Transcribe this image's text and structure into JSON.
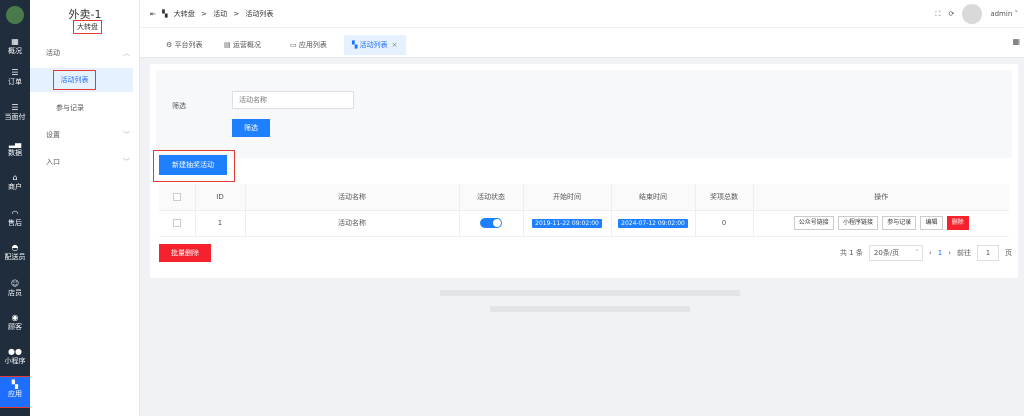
{
  "rail": {
    "items": [
      {
        "label": "概况"
      },
      {
        "label": "订单"
      },
      {
        "label": "当面付"
      },
      {
        "label": "数据"
      },
      {
        "label": "商户"
      },
      {
        "label": "售后"
      },
      {
        "label": "配送员"
      },
      {
        "label": "店员"
      },
      {
        "label": "顾客"
      },
      {
        "label": "小程序"
      },
      {
        "label": "应用"
      }
    ],
    "active_index": 10
  },
  "sidebar": {
    "title": "外卖-1",
    "subtitle": "大转盘",
    "groups": [
      {
        "label": "活动",
        "items": [
          "活动列表",
          "参与记录"
        ]
      },
      {
        "label": "设置"
      },
      {
        "label": "入口"
      }
    ],
    "active_item": "活动列表"
  },
  "breadcrumb": [
    "大转盘",
    "活动",
    "活动列表"
  ],
  "topbar": {
    "user": "admin"
  },
  "tabs": [
    {
      "label": "平台列表"
    },
    {
      "label": "运营概况"
    },
    {
      "label": "应用列表"
    },
    {
      "label": "活动列表",
      "active": true
    }
  ],
  "filter": {
    "label": "筛选",
    "placeholder": "活动名称",
    "button": "筛选"
  },
  "create_button": "新建抽奖活动",
  "table": {
    "columns": [
      "ID",
      "活动名称",
      "活动状态",
      "开始时间",
      "结束时间",
      "奖项总数",
      "操作"
    ],
    "rows": [
      {
        "id": "1",
        "name": "活动名称",
        "status_on": true,
        "start": "2019-11-22 09:02:00",
        "end": "2024-07-12 09:02:00",
        "prizes": "0",
        "actions": [
          "公众号链接",
          "小程序链接",
          "参与记录",
          "编辑",
          "删除"
        ]
      }
    ]
  },
  "bulk_delete": "批量删除",
  "pagination": {
    "total": "共 1 条",
    "page_size": "20条/页",
    "current": "1",
    "goto_label": "前往",
    "goto_value": "1",
    "page_suffix": "页"
  },
  "colors": {
    "primary": "#1e80ff",
    "danger": "#f5222d",
    "rail": "#1f2d3d",
    "highlight": "#e53935"
  }
}
